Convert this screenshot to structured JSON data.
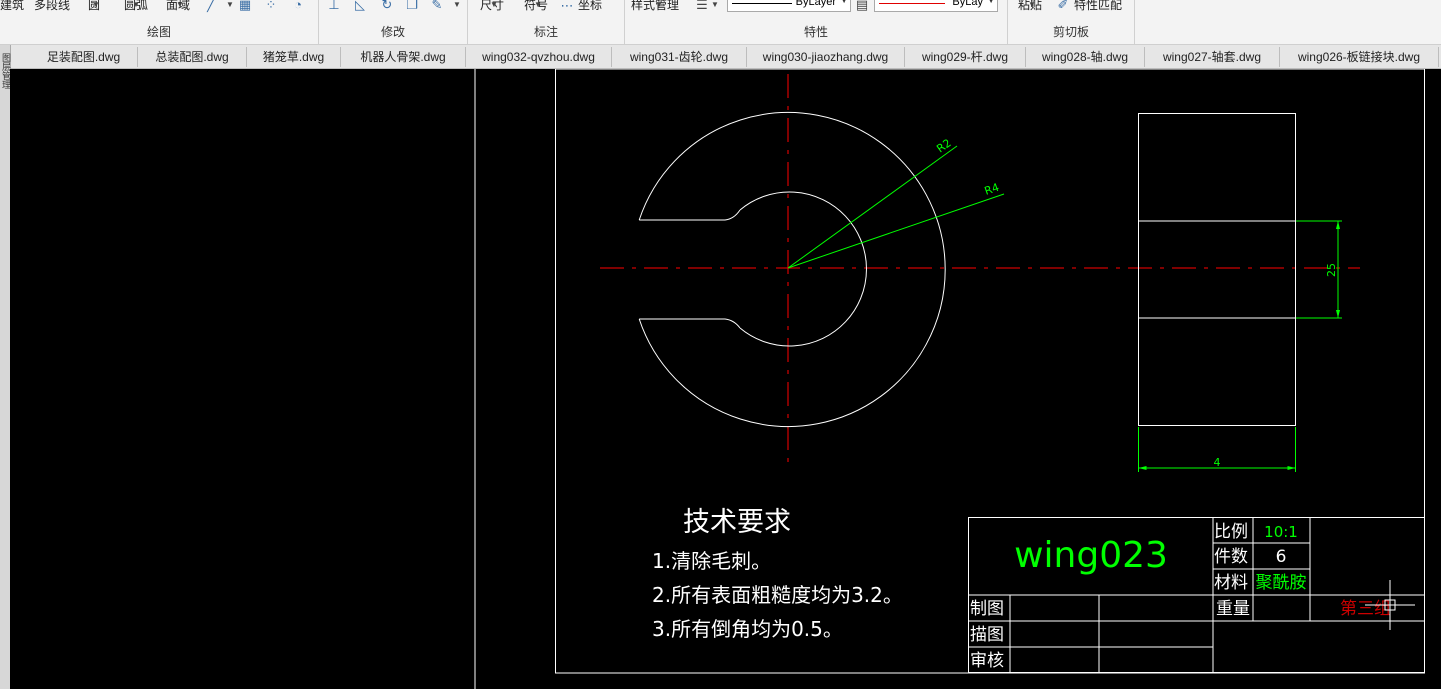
{
  "ribbon": {
    "top_labels": [
      "建筑",
      "多段线",
      "圆",
      "圆弧",
      "面域",
      "尺寸",
      "符号",
      "坐标",
      "样式管理",
      "粘贴",
      "特性匹配"
    ],
    "groups": {
      "draw": "绘图",
      "modify": "修改",
      "annotate": "标注",
      "properties": "特性",
      "clipboard": "剪切板"
    },
    "linetype_value": "ByLayer",
    "color_value": "ByLayer",
    "color_value_short": "ByLay"
  },
  "tabs": [
    "足装配图.dwg",
    "总装配图.dwg",
    "猪笼草.dwg",
    "机器人骨架.dwg",
    "wing032-qvzhou.dwg",
    "wing031-齿轮.dwg",
    "wing030-jiaozhang.dwg",
    "wing029-杆.dwg",
    "wing028-轴.dwg",
    "wing027-轴套.dwg",
    "wing026-板链接块.dwg"
  ],
  "left_strip_label": "图层管理",
  "drawing": {
    "dimensions": {
      "r2": "R2",
      "r4": "R4",
      "height": "25",
      "width": "4"
    },
    "tech_title": "技术要求",
    "tech_items": [
      "1.清除毛刺。",
      "2.所有表面粗糙度均为3.2。",
      "3.所有倒角均为0.5。"
    ],
    "title_block": {
      "part_name": "wing023",
      "scale_label": "比例",
      "scale_value": "10:1",
      "count_label": "件数",
      "count_value": "6",
      "material_label": "材料",
      "material_value": "聚酰胺",
      "weight_label": "重量",
      "drawn_label": "制图",
      "traced_label": "描图",
      "checked_label": "审核",
      "group_mark": "第三组"
    }
  },
  "colors": {
    "cad_background": "#000000",
    "geometry": "#ffffff",
    "centerline": "#ff0000",
    "dimension": "#00ff00",
    "part_name": "#00ff00",
    "group_mark": "#cc0000"
  }
}
